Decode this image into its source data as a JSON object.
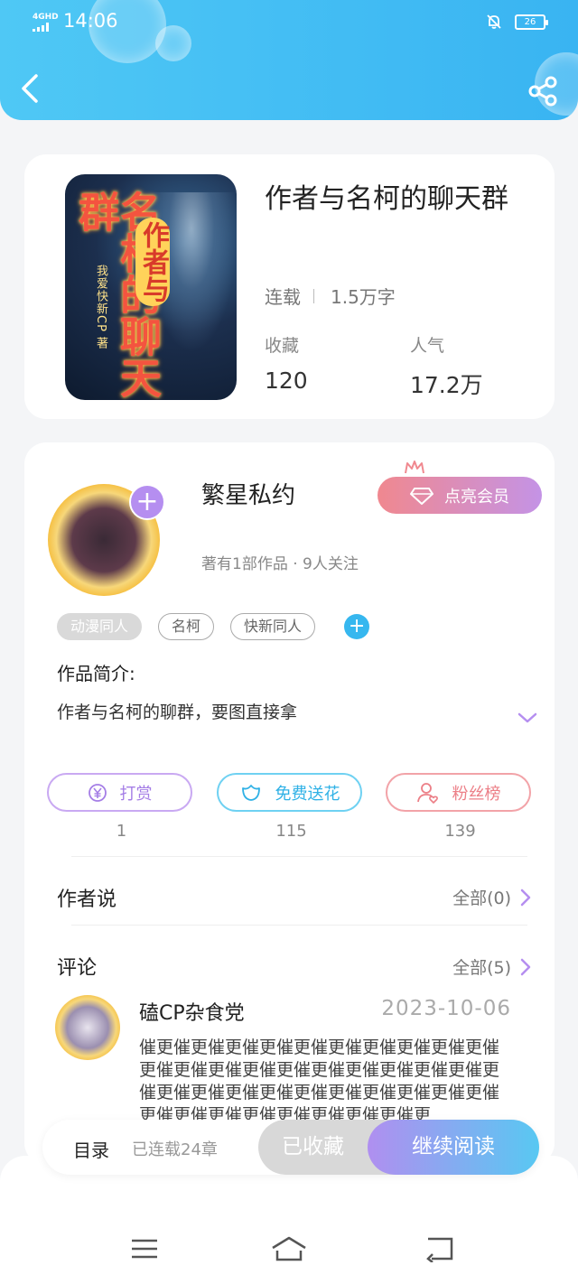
{
  "status_bar": {
    "network": "4GHD",
    "time": "14:06",
    "battery": "26"
  },
  "colors": {
    "header": "#3fbdf4",
    "accent_purple": "#b58ef0",
    "accent_blue": "#36b7ef",
    "accent_pink": "#f0888f"
  },
  "book": {
    "title": "作者与名柯的聊天群",
    "status": "连载",
    "word_count": "1.5万字",
    "favorites_label": "收藏",
    "favorites_value": "120",
    "popularity_label": "人气",
    "popularity_value": "17.2万",
    "cover_title": "名柯的聊天群",
    "cover_badge": "作者与",
    "cover_author": "我爱快新CP 著"
  },
  "author": {
    "name": "繁星私约",
    "vip_button": "点亮会员",
    "meta": "著有1部作品 · 9人关注"
  },
  "tags": [
    "动漫同人",
    "名柯",
    "快新同人"
  ],
  "intro": {
    "label": "作品简介:",
    "text": "作者与名柯的聊群，要图直接拿"
  },
  "actions": [
    {
      "label": "打赏",
      "count": "1",
      "icon": "yen-icon"
    },
    {
      "label": "免费送花",
      "count": "115",
      "icon": "flower-icon"
    },
    {
      "label": "粉丝榜",
      "count": "139",
      "icon": "fans-icon"
    }
  ],
  "author_says": {
    "title": "作者说",
    "more": "全部(0)"
  },
  "comments": {
    "title": "评论",
    "more": "全部(5)",
    "first": {
      "name": "磕CP杂食党",
      "date": "2023-10-06",
      "body": "催更催更催更催更催更催更催更催更催更催更催更催更催更催更催更催更催更催更催更催更催更催更催更催更催更催更催更催更催更催更催更催更催更催更催更催更催更催更催更催更"
    }
  },
  "bottom_bar": {
    "toc": "目录",
    "chapters": "已连载24章",
    "favorited": "已收藏",
    "continue": "继续阅读"
  }
}
